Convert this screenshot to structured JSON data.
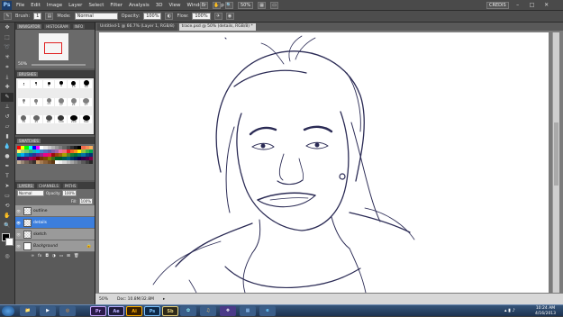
{
  "menubar": {
    "app_badge": "Ps",
    "items": [
      "File",
      "Edit",
      "Image",
      "Layer",
      "Select",
      "Filter",
      "Analysis",
      "3D",
      "View",
      "Window",
      "Help"
    ],
    "zoom": "50%",
    "workspace": "CREDIS",
    "win_min": "–",
    "win_max": "□",
    "win_close": "✕"
  },
  "options": {
    "brush_label": "Brush:",
    "brush_size": "1",
    "mode_label": "Mode:",
    "mode_value": "Normal",
    "opacity_label": "Opacity:",
    "opacity_value": "100%",
    "flow_label": "Flow:",
    "flow_value": "100%"
  },
  "navigator": {
    "tabs": [
      "NAVIGATOR",
      "HISTOGRAM",
      "INFO"
    ],
    "zoom": "50%"
  },
  "brushes": {
    "tab": "BRUSHES",
    "sizes": [
      "1",
      "3",
      "5",
      "9",
      "13",
      "19",
      "5",
      "9",
      "13",
      "17",
      "21",
      "27",
      "35",
      "45",
      "65",
      "100",
      "200",
      "300"
    ]
  },
  "swatches": {
    "tab": "SWATCHES"
  },
  "layers": {
    "tabs": [
      "LAYERS",
      "CHANNELS",
      "PATHS"
    ],
    "blend": "Normal",
    "opacity_label": "Opacity:",
    "opacity": "100%",
    "fill_label": "Fill:",
    "fill": "100%",
    "items": [
      {
        "name": "outline",
        "selected": false
      },
      {
        "name": "details",
        "selected": true
      },
      {
        "name": "sketch",
        "selected": false
      },
      {
        "name": "Background",
        "selected": false
      }
    ]
  },
  "document": {
    "tabs": [
      "Untitled-1 @ 66.7% (Layer 1, RGB/8)",
      "trace.psd @ 50% (details, RGB/8) *"
    ],
    "status_zoom": "50%",
    "doc_size": "Doc: 10.8M/32.8M"
  },
  "taskbar": {
    "apps": [
      {
        "label": "Pr",
        "bg": "#2a1a4a",
        "fg": "#c7a6ff"
      },
      {
        "label": "Ae",
        "bg": "#1e1b3d",
        "fg": "#b7b0ff"
      },
      {
        "label": "Ai",
        "bg": "#3a2000",
        "fg": "#ffb000"
      },
      {
        "label": "Ps",
        "bg": "#0d2a4a",
        "fg": "#7ec4ff"
      },
      {
        "label": "Sb",
        "bg": "#2e2a1a",
        "fg": "#e6d17a"
      }
    ],
    "time": "10:24 AM",
    "date": "4/16/2013"
  },
  "colors": {
    "selection": "#3c7edc",
    "line": "#2b2b55",
    "panel": "#5a5a5a"
  }
}
